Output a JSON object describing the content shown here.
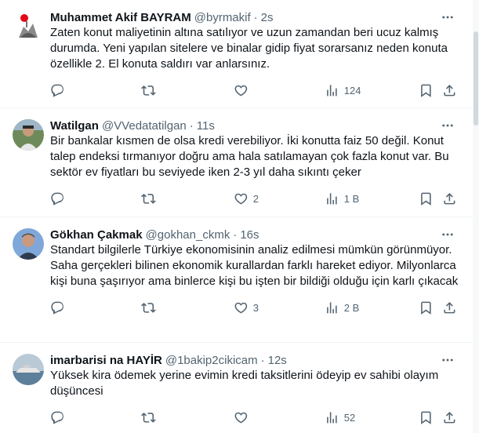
{
  "tweets": [
    {
      "name": "Muhammet Akif BAYRAM",
      "handle": "@byrmakif",
      "time": "2s",
      "text": "Zaten konut maliyetinin altına satılıyor ve uzun zamandan beri ucuz kalmış durumda. Yeni yapılan sitelere ve binalar gidip fiyat sorarsanız neden konuta özellikle 2. El konuta saldırı var anlarsınız.",
      "replies": "",
      "retweets": "",
      "likes": "",
      "views": "124"
    },
    {
      "name": "Watilgan",
      "handle": "@VVedatatilgan",
      "time": "11s",
      "text": "Bir bankalar kısmen de olsa kredi verebiliyor. İki konutta faiz 50 değil. Konut talep endeksi tırmanıyor doğru ama hala satılamayan çok fazla konut var. Bu sektör ev fiyatları bu seviyede iken  2-3 yıl daha sıkıntı çeker",
      "replies": "",
      "retweets": "",
      "likes": "2",
      "views": "1 B"
    },
    {
      "name": "Gökhan Çakmak",
      "handle": "@gokhan_ckmk",
      "time": "16s",
      "text": "Standart bilgilerle Türkiye ekonomisinin analiz edilmesi mümkün görünmüyor. Saha gerçekleri bilinen ekonomik kurallardan farklı hareket ediyor. Milyonlarca kişi buna şaşırıyor ama binlerce kişi bu işten bir bildiği olduğu için karlı çıkacak",
      "replies": "",
      "retweets": "",
      "likes": "3",
      "views": "2 B"
    },
    {
      "name": "imarbarisi na HAYİR",
      "handle": "@1bakip2cikicam",
      "time": "12s",
      "text": "Yüksek kira ödemek yerine evimin kredi taksitlerini ödeyip ev sahibi olayım düşüncesi",
      "replies": "",
      "retweets": "",
      "likes": "",
      "views": "52"
    }
  ],
  "icons": {
    "reply": "reply-icon",
    "retweet": "retweet-icon",
    "like": "heart-icon",
    "views": "views-icon",
    "bookmark": "bookmark-icon",
    "share": "share-icon",
    "more": "more-icon"
  },
  "colors": {
    "text": "#0f1419",
    "secondary": "#536471",
    "divider": "#eff3f4"
  }
}
